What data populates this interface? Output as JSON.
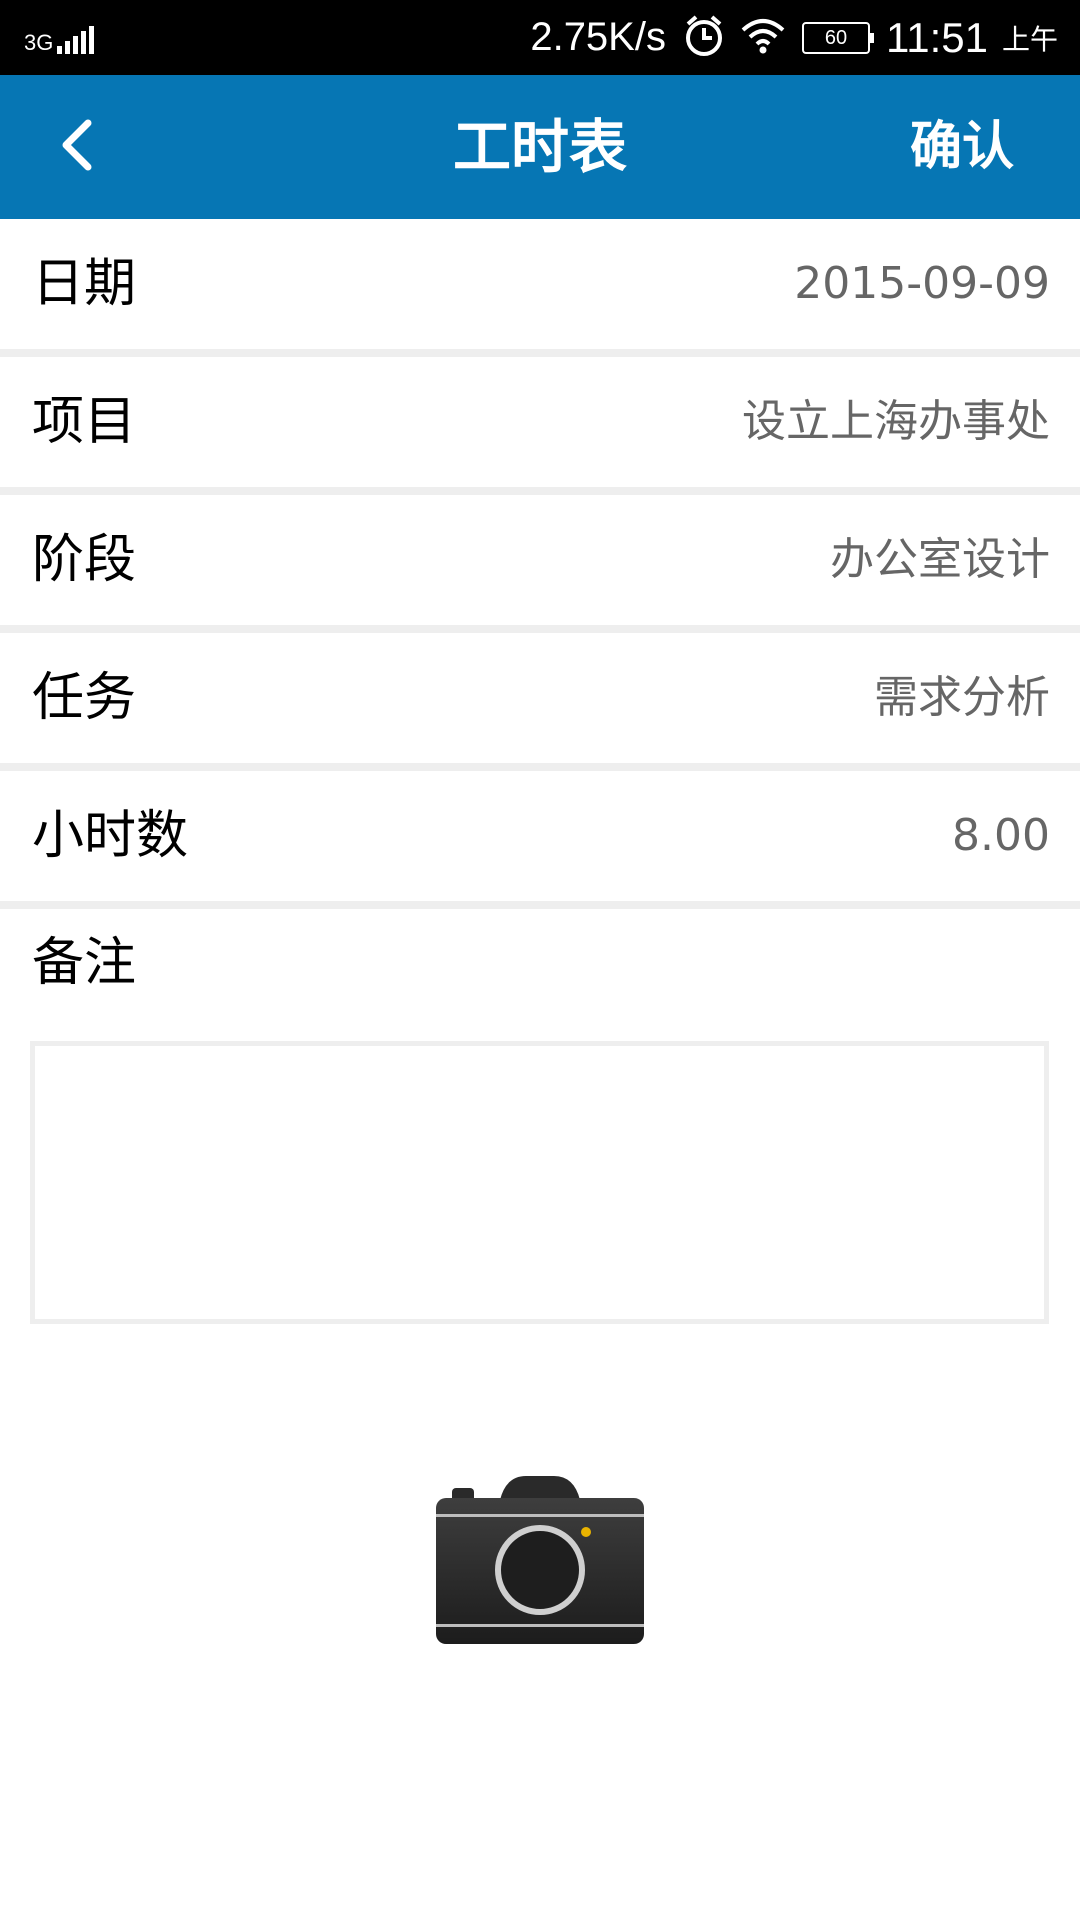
{
  "status_bar": {
    "network": "3G",
    "speed": "2.75K/s",
    "battery": "60",
    "time": "11:51",
    "ampm": "上午"
  },
  "app_bar": {
    "title": "工时表",
    "confirm_label": "确认",
    "background_color": "#0676b4"
  },
  "form": {
    "rows": [
      {
        "label": "日期",
        "value": "2015-09-09"
      },
      {
        "label": "项目",
        "value": "设立上海办事处"
      },
      {
        "label": "阶段",
        "value": "办公室设计"
      },
      {
        "label": "任务",
        "value": "需求分析"
      },
      {
        "label": "小时数",
        "value": "8.00"
      }
    ],
    "remarks_label": "备注",
    "remarks_value": ""
  },
  "icons": {
    "back": "chevron-left-icon",
    "camera": "camera-icon"
  }
}
